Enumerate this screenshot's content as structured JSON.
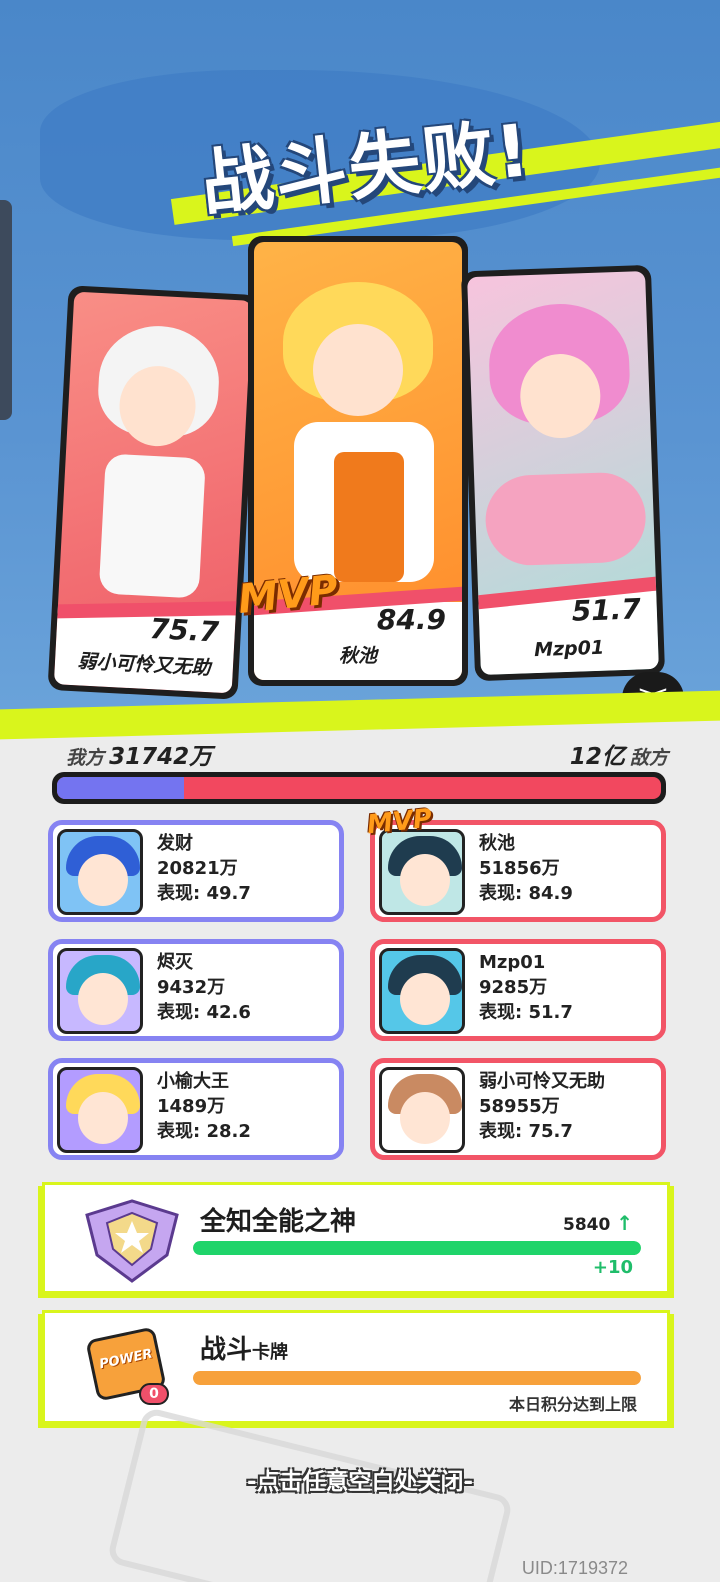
{
  "result_title": "战斗失败!",
  "featured_players": [
    {
      "name": "弱小可怜又无助",
      "score": "75.7"
    },
    {
      "name": "秋池",
      "score": "84.9",
      "mvp": "MVP"
    },
    {
      "name": "Mzp01",
      "score": "51.7"
    }
  ],
  "bubble_text": "><",
  "team_summary": {
    "my_label": "我方",
    "my_total": "31742万",
    "enemy_total": "12亿",
    "enemy_label": "敌方",
    "my_share": 0.21
  },
  "my_team": [
    {
      "name": "发财",
      "total": "20821万",
      "performance": "表现: 49.7"
    },
    {
      "name": "烬灭",
      "total": "9432万",
      "performance": "表现: 42.6"
    },
    {
      "name": "小榆大王",
      "total": "1489万",
      "performance": "表现: 28.2"
    }
  ],
  "enemy_team": [
    {
      "name": "秋池",
      "total": "51856万",
      "performance": "表现: 84.9",
      "mvp": "MVP"
    },
    {
      "name": "Mzp01",
      "total": "9285万",
      "performance": "表现: 51.7"
    },
    {
      "name": "弱小可怜又无助",
      "total": "58955万",
      "performance": "表现: 75.7"
    }
  ],
  "rank": {
    "title": "全知全能之神",
    "points": "5840",
    "arrow": "↑",
    "delta": "+10",
    "progress": 1.0,
    "color": "#1fd46a"
  },
  "battle_card": {
    "title": "战斗",
    "subtitle": "卡牌",
    "badge_text": "POWER",
    "badge_count": "0",
    "limit_text": "本日积分达到上限",
    "progress": 1.0,
    "color": "#f7a13b"
  },
  "close_hint": "-点击任意空白处关闭-",
  "uid": "UID:1719372",
  "colors": {
    "my_team": "#8683f2",
    "enemy_team": "#f25567",
    "accent_yellow": "#d9f51c",
    "mvp_orange": "#ff9b1a"
  }
}
